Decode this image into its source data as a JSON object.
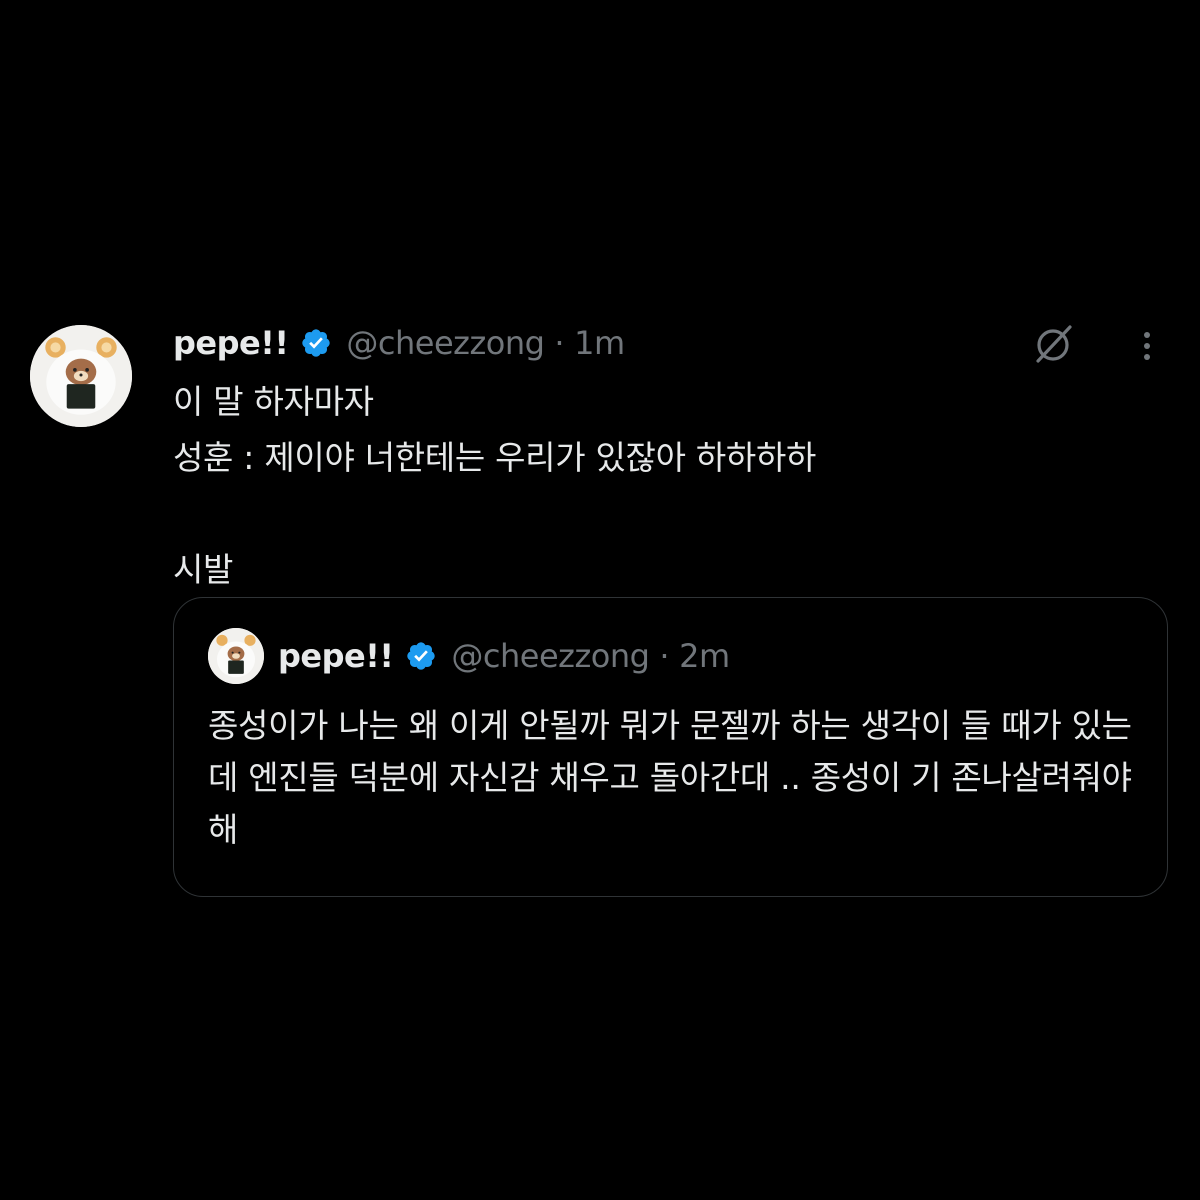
{
  "tweet": {
    "author": {
      "display_name": "pepe!!",
      "handle": "@cheezzong",
      "separator": "·",
      "time": "1m",
      "verified": true,
      "avatar_icon": "rilakkuma-onigiri-avatar"
    },
    "text": "이 말 하자마자\n성훈 : 제이야 너한테는 우리가 있잖아 하하하하\n\n시발",
    "actions": {
      "grok_icon": "grok-icon",
      "more_icon": "more-options-icon"
    },
    "quoted_tweet": {
      "author": {
        "display_name": "pepe!!",
        "handle": "@cheezzong",
        "separator": "·",
        "time": "2m",
        "verified": true,
        "avatar_icon": "rilakkuma-onigiri-avatar"
      },
      "text": "종성이가 나는 왜 이게 안될까 뭐가 문젤까 하는 생각이 들 때가 있는데 엔진들 덕분에 자신감 채우고 돌아간대 .. 종성이 기 존나살려줘야해"
    }
  },
  "colors": {
    "background": "#000000",
    "primary_text": "#e7e9ea",
    "secondary_text": "#71767b",
    "verified_blue": "#1d9bf0",
    "border": "#2f3336"
  }
}
